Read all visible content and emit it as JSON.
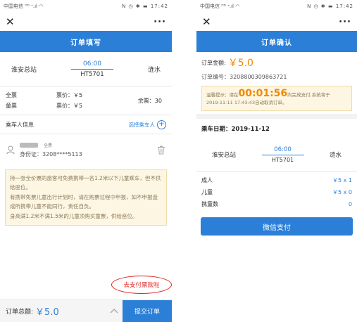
{
  "left": {
    "status_bar": {
      "carrier": "中国电信 ᴴᴰ ᐩ.ıl ◠",
      "icons": "N ◷ ✱ ▬ 17:42"
    },
    "title": "订单填写",
    "train": {
      "from": "淮安总站",
      "time": "06:00",
      "train_no": "HT5701",
      "to": "涟水"
    },
    "tickets": {
      "adult_label": "全票",
      "adult_price": "票价：￥5",
      "child_label": "童票",
      "child_price": "票价：￥5",
      "remaining": "余票：30"
    },
    "passengers": {
      "header": "乘车人信息",
      "select_label": "选择乘车人",
      "items": [
        {
          "type": "全票",
          "id": "身份证：3208****5113"
        }
      ]
    },
    "notice": [
      "持一张全价票的旅客可免费携带一名1.2米以下儿童乘车，但不供给座位。",
      "有携带免票儿童出行计划时，请在购票过程中申报，如不申报造成所携带儿童不能同行，责任自负。",
      "身高满1.2米不满1.5米的儿童须购买童票，供给座位。"
    ],
    "bubble_text": "去支付票款啦",
    "footer": {
      "total_label": "订单总额:",
      "total_value": "￥5.0",
      "submit": "提交订单"
    }
  },
  "right": {
    "status_bar": {
      "carrier": "中国电信 ᴴᴰ ᐩ.ıl ◠",
      "icons": "N ◷ ✱ ▬ 17:42"
    },
    "title": "订单确认",
    "amount_label": "订单金额:",
    "amount_value": "￥5.0",
    "order_no": "订单编号：3208800309863721",
    "warm": {
      "prefix": "温馨提示：请在",
      "countdown": "00:01:56",
      "suffix": "内完成支付,系统将于",
      "line2": "2019-11-11 17:43:43自动取消订单。"
    },
    "date": "乘车日期：2019-11-12",
    "train": {
      "from": "淮安总站",
      "time": "06:00",
      "train_no": "HT5701",
      "to": "涟水"
    },
    "rows": [
      {
        "label": "成人",
        "value": "￥5 x 1"
      },
      {
        "label": "儿童",
        "value": "￥5 x 0"
      },
      {
        "label": "携童数",
        "value": "0"
      }
    ],
    "pay_button": "微信支付"
  },
  "colors": {
    "accent": "#2b7fd7",
    "orange": "#f08a00",
    "notice_bg": "#fdf6e3",
    "bubble": "#dd2222"
  }
}
